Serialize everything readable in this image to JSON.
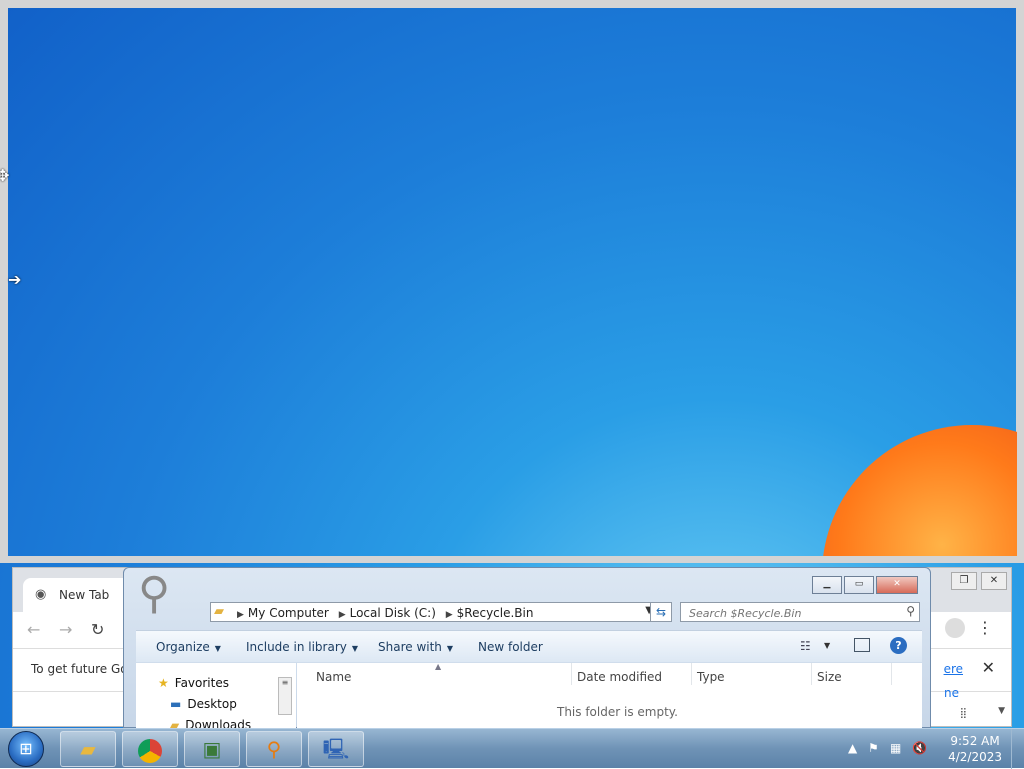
{
  "chrome": {
    "tab_title": "New Tab",
    "infobar_message": "To get future Go",
    "infobar_link": "ere",
    "lower_link": "ne"
  },
  "explorer": {
    "address": {
      "crumbs": [
        "My Computer",
        "Local Disk (C:)",
        "$Recycle.Bin"
      ]
    },
    "search": {
      "placeholder": "Search $Recycle.Bin"
    },
    "commands": {
      "organize": "Organize",
      "include_in_library": "Include in library",
      "share_with": "Share with",
      "new_folder": "New folder"
    },
    "nav": {
      "favorites": "Favorites",
      "desktop": "Desktop",
      "downloads": "Downloads"
    },
    "columns": {
      "name": "Name",
      "date_modified": "Date modified",
      "type": "Type",
      "size": "Size"
    },
    "empty_message": "This folder is empty."
  },
  "taskbar": {
    "clock": {
      "time": "9:52 AM",
      "date": "4/2/2023"
    }
  },
  "icons": {
    "start": "windows-orb-icon",
    "explorer": "folder-icon",
    "chrome": "chrome-icon",
    "taskmgr": "monitor-icon",
    "search_app": "magnifier-icon",
    "network": "computer-icon"
  }
}
